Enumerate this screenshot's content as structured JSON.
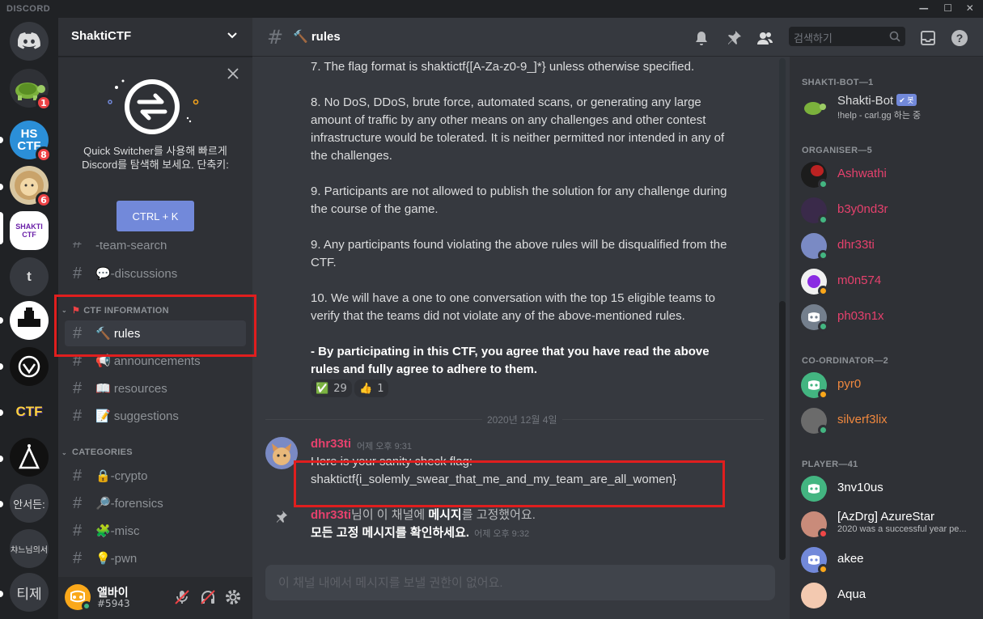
{
  "titlebar": {
    "brand": "DISCORD",
    "min": "—",
    "max": "☐",
    "close": "✕"
  },
  "servers": [
    {
      "name": "home",
      "badge": ""
    },
    {
      "name": "turtle",
      "badge": "1"
    },
    {
      "name": "HSCTF",
      "label": "HS\nCTF",
      "badge": "8"
    },
    {
      "name": "lion",
      "badge": "6"
    },
    {
      "name": "ShaktiCTF",
      "label": "SHAKTI\nCTF",
      "badge": ""
    },
    {
      "name": "t",
      "label": "t",
      "badge": ""
    },
    {
      "name": "castle",
      "badge": ""
    },
    {
      "name": "shield",
      "badge": ""
    },
    {
      "name": "CTF",
      "label": "CTF",
      "badge": ""
    },
    {
      "name": "triangle",
      "badge": ""
    },
    {
      "name": "server-안서든",
      "label": "안서든:",
      "badge": ""
    },
    {
      "name": "server-챠느님",
      "label": "챠느님의서",
      "badge": ""
    },
    {
      "name": "server-티제",
      "label": "티제",
      "badge": ""
    }
  ],
  "guild": {
    "name": "ShaktiCTF"
  },
  "switcher": {
    "text": "Quick Switcher를 사용해 빠르게 Discord를 탐색해 보세요. 단축키:",
    "button": "CTRL + K"
  },
  "channels": {
    "team_search": "-team-search",
    "discussions": "💬-discussions",
    "cat_info": "CTF INFORMATION",
    "rules": "🔨 rules",
    "announcements": "📢 announcements",
    "resources": "📖 resources",
    "suggestions": "📝 suggestions",
    "cat_categories": "CATEGORIES",
    "crypto": "🔒-crypto",
    "forensics": "🔎-forensics",
    "misc": "🧩-misc",
    "pwn": "💡-pwn"
  },
  "user": {
    "name": "앨바이",
    "tag": "#5943"
  },
  "header": {
    "channel": "🔨 rules",
    "search_placeholder": "검색하기"
  },
  "rules_text": {
    "r7": "7. The flag format is shaktictf{[A-Za-z0-9_]*} unless otherwise specified.",
    "r8": "8. No DoS, DDoS, brute force, automated scans, or generating any large amount of traffic by any other means on any challenges and other contest infrastructure would be tolerated. It is neither permitted nor intended in any of the challenges.",
    "r9a": "9. Participants are not allowed to publish the solution for any challenge during the course of the game.",
    "r9b": "9. Any participants found violating the above rules will be disqualified from the CTF.",
    "r10": "10. We will have a one to one conversation with the top 15 eligible teams to verify that the teams did not violate any of the above-mentioned rules.",
    "final": "- By participating in this CTF, you agree that you have read the above rules and fully agree to adhere to them."
  },
  "reactions": [
    {
      "emoji": "✅",
      "count": "29"
    },
    {
      "emoji": "👍",
      "count": "1"
    }
  ],
  "date_divider": "2020년 12월 4일",
  "message": {
    "author": "dhr33ti",
    "timestamp": "어제 오후 9:31",
    "line1": "Here is your sanity check flag:",
    "line2": "shaktictf{i_solemly_swear_that_me_and_my_team_are_all_women}"
  },
  "pin_notice": {
    "author": "dhr33ti",
    "text": "님이 이 채널에 ",
    "bold": "메시지",
    "text2": "를 고정했어요.",
    "link": "모든 고정 메시지를 확인하세요.",
    "timestamp": "어제 오후 9:32"
  },
  "input_placeholder": "이 채널 내에서 메시지를 보낼 권한이 없어요.",
  "members": {
    "cat_bot": "SHAKTI-BOT—1",
    "bot": {
      "name": "Shakti-Bot",
      "badge": "✔ 봇",
      "status": "!help - carl.gg 하는 중"
    },
    "cat_org": "ORGANISER—5",
    "organisers": [
      "Ashwathi",
      "b3y0nd3r",
      "dhr33ti",
      "m0n574",
      "ph03n1x"
    ],
    "cat_coord": "CO-ORDINATOR—2",
    "coordinators": [
      "pyr0",
      "silverf3lix"
    ],
    "cat_player": "PLAYER—41",
    "players": [
      {
        "name": "3nv10us",
        "status": ""
      },
      {
        "name": "[AzDrg] AzureStar",
        "status": "2020 was a successful year pe..."
      },
      {
        "name": "akee",
        "status": ""
      },
      {
        "name": "Aqua",
        "status": ""
      }
    ]
  },
  "colors": {
    "organiser": "#e6416d",
    "coordinator": "#f0883e",
    "highlight": "#e01e1e",
    "blurple": "#7289da"
  }
}
